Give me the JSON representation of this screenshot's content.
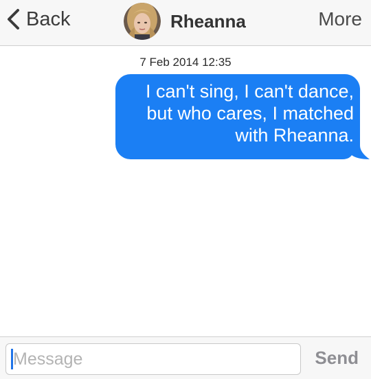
{
  "header": {
    "back_label": "Back",
    "contact_name": "Rheanna",
    "more_label": "More",
    "back_icon": "chevron-left-icon"
  },
  "conversation": {
    "timestamp": "7 Feb 2014 12:35",
    "messages": [
      {
        "direction": "outgoing",
        "text": "I can't sing, I can't dance, but who cares, I matched with Rheanna."
      }
    ]
  },
  "composer": {
    "placeholder": "Message",
    "value": "",
    "send_label": "Send"
  },
  "colors": {
    "bubble_outgoing": "#1b7ff4",
    "send_disabled": "#8e8e93",
    "header_bg": "#f7f7f7"
  }
}
